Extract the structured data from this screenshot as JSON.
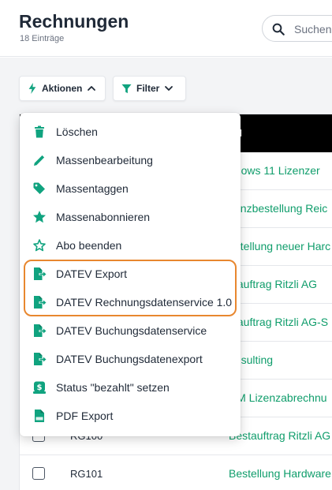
{
  "header": {
    "title": "Rechnungen",
    "count": "18 Einträge",
    "search_placeholder": "Suchen..."
  },
  "toolbar": {
    "actions_label": "Aktionen",
    "filter_label": "Filter"
  },
  "table": {
    "header_fragment": "el",
    "rows": [
      {
        "link": "ndows 11 Lizenzer"
      },
      {
        "link": "zenzbestellung Reic"
      },
      {
        "link": "estellung neuer Harc"
      },
      {
        "link": "stauftrag Ritzli AG"
      },
      {
        "link": "stauftrag Ritzli AG-S"
      },
      {
        "link": "onsulting"
      },
      {
        "link": "RM Lizenzabrechnu"
      },
      {
        "id": "RG100",
        "link": "Bestauftrag Ritzli AG"
      },
      {
        "id": "RG101",
        "link": "Bestellung Hardware"
      }
    ]
  },
  "menu": {
    "items": [
      {
        "label": "Löschen",
        "icon": "trash-icon"
      },
      {
        "label": "Massenbearbeitung",
        "icon": "pencil-icon"
      },
      {
        "label": "Massentaggen",
        "icon": "tag-icon"
      },
      {
        "label": "Massenabonnieren",
        "icon": "star-filled-icon"
      },
      {
        "label": "Abo beenden",
        "icon": "star-outline-icon"
      },
      {
        "label": "DATEV Export",
        "icon": "file-export-icon"
      },
      {
        "label": "DATEV Rechnungsdatenservice 1.0",
        "icon": "file-export-icon"
      },
      {
        "label": "DATEV Buchungsdatenservice",
        "icon": "file-export-icon"
      },
      {
        "label": "DATEV Buchungsdatenexport",
        "icon": "file-export-icon"
      },
      {
        "label": "Status \"bezahlt\" setzen",
        "icon": "money-icon"
      },
      {
        "label": "PDF Export",
        "icon": "pdf-file-icon"
      }
    ]
  },
  "colors": {
    "accent": "#10a37f",
    "highlight": "#e8872f",
    "link": "#0f9d6b"
  }
}
